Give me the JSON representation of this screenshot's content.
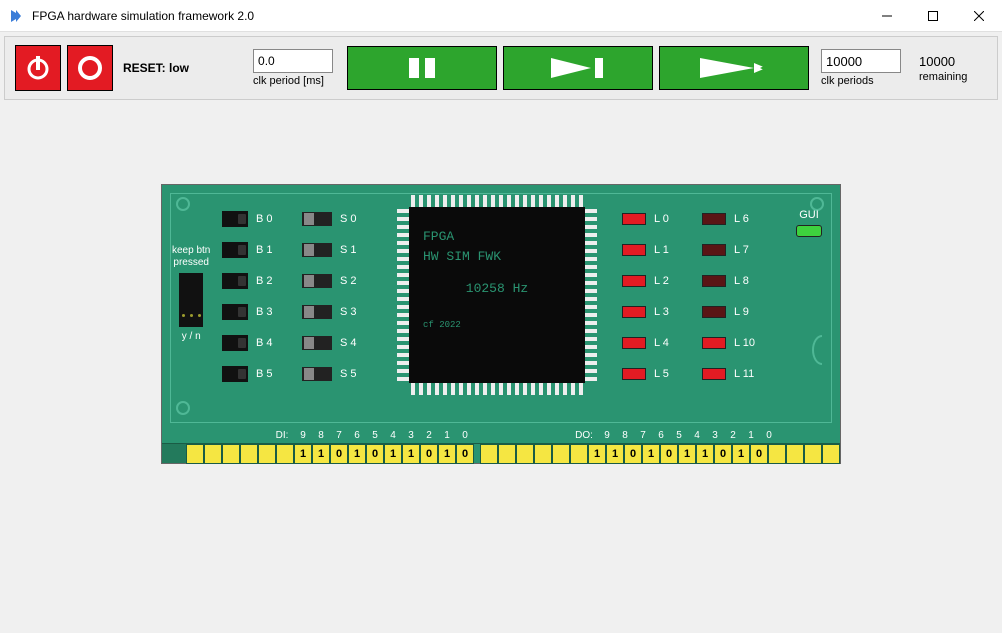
{
  "window": {
    "title": "FPGA hardware simulation framework 2.0"
  },
  "toolbar": {
    "reset_label": "RESET: low",
    "clk_period_value": "0.0",
    "clk_period_label": "clk period [ms]",
    "clk_periods_value": "10000",
    "clk_periods_label": "clk periods",
    "remaining_value": "10000",
    "remaining_label": "remaining"
  },
  "board": {
    "keep_btn_line1": "keep btn",
    "keep_btn_line2": "pressed",
    "yn_label": "y / n",
    "buttons": [
      {
        "label": "B 0"
      },
      {
        "label": "B 1"
      },
      {
        "label": "B 2"
      },
      {
        "label": "B 3"
      },
      {
        "label": "B 4"
      },
      {
        "label": "B 5"
      }
    ],
    "switches": [
      {
        "label": "S 0"
      },
      {
        "label": "S 1"
      },
      {
        "label": "S 2"
      },
      {
        "label": "S 3"
      },
      {
        "label": "S 4"
      },
      {
        "label": "S 5"
      }
    ],
    "chip": {
      "line1": "FPGA",
      "line2": "HW SIM FWK",
      "freq": "10258 Hz",
      "year": "cf 2022"
    },
    "leds_left": [
      {
        "label": "L 0",
        "on": true
      },
      {
        "label": "L 1",
        "on": true
      },
      {
        "label": "L 2",
        "on": true
      },
      {
        "label": "L 3",
        "on": true
      },
      {
        "label": "L 4",
        "on": true
      },
      {
        "label": "L 5",
        "on": true
      }
    ],
    "leds_right": [
      {
        "label": "L 6",
        "on": false
      },
      {
        "label": "L 7",
        "on": false
      },
      {
        "label": "L 8",
        "on": false
      },
      {
        "label": "L 9",
        "on": false
      },
      {
        "label": "L 10",
        "on": true
      },
      {
        "label": "L 11",
        "on": true
      }
    ],
    "gui_label": "GUI",
    "di_label": "DI:",
    "do_label": "DO:",
    "di_indices": [
      "9",
      "8",
      "7",
      "6",
      "5",
      "4",
      "3",
      "2",
      "1",
      "0"
    ],
    "do_indices": [
      "9",
      "8",
      "7",
      "6",
      "5",
      "4",
      "3",
      "2",
      "1",
      "0"
    ],
    "di_values": [
      "1",
      "1",
      "0",
      "1",
      "0",
      "1",
      "1",
      "0",
      "1",
      "0"
    ],
    "do_values": [
      "1",
      "1",
      "0",
      "1",
      "0",
      "1",
      "1",
      "0",
      "1",
      "0"
    ]
  }
}
